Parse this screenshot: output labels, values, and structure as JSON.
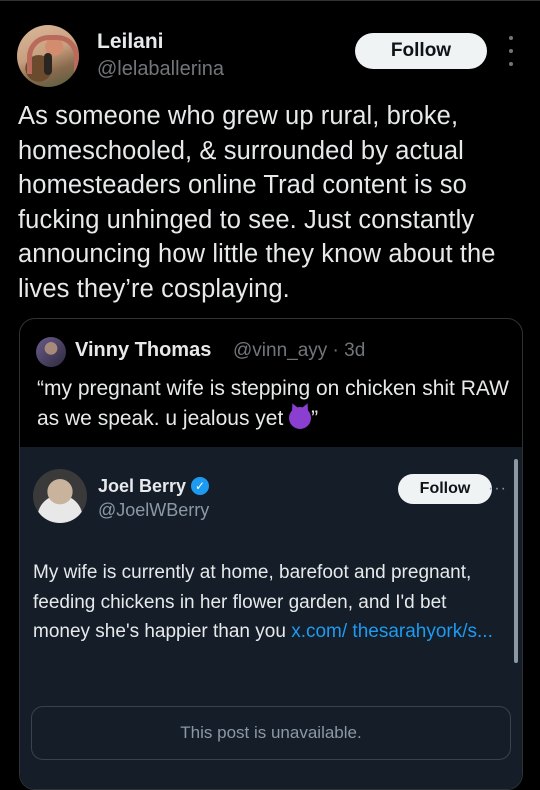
{
  "post": {
    "author_name": "Leilani",
    "author_handle": "@lelaballerina",
    "follow_label": "Follow",
    "text": "As someone who grew up rural, broke, homeschooled, & surrounded by actual homesteaders online Trad content is so fucking unhinged to see. Just constantly announcing how little they know about the lives they’re cosplaying."
  },
  "quote": {
    "author_name": "Vinny Thomas",
    "author_handle_time": "@vinn_ayy · 3d",
    "text": "“my pregnant wife is stepping on chicken shit RAW as we speak. u jealous yet ",
    "text_end": "”"
  },
  "embed": {
    "author_name": "Joel Berry",
    "author_handle": "@JoelWBerry",
    "follow_label": "Follow",
    "more_label": "···",
    "text": "My wife is currently at home, barefoot and pregnant, feeding chickens in her flower garden, and I'd bet money she's happier than you ",
    "link": "x.com/ thesarahyork/s...",
    "unavailable_text": "This post is unavailable."
  },
  "icons": {
    "more": "more-vertical-icon",
    "verified": "verified-badge-icon",
    "devil_emoji": "smiling-devil-emoji"
  },
  "colors": {
    "background": "#000000",
    "link": "#1d9bf0",
    "verified": "#1d9bf0",
    "embed_background": "#141d28"
  }
}
